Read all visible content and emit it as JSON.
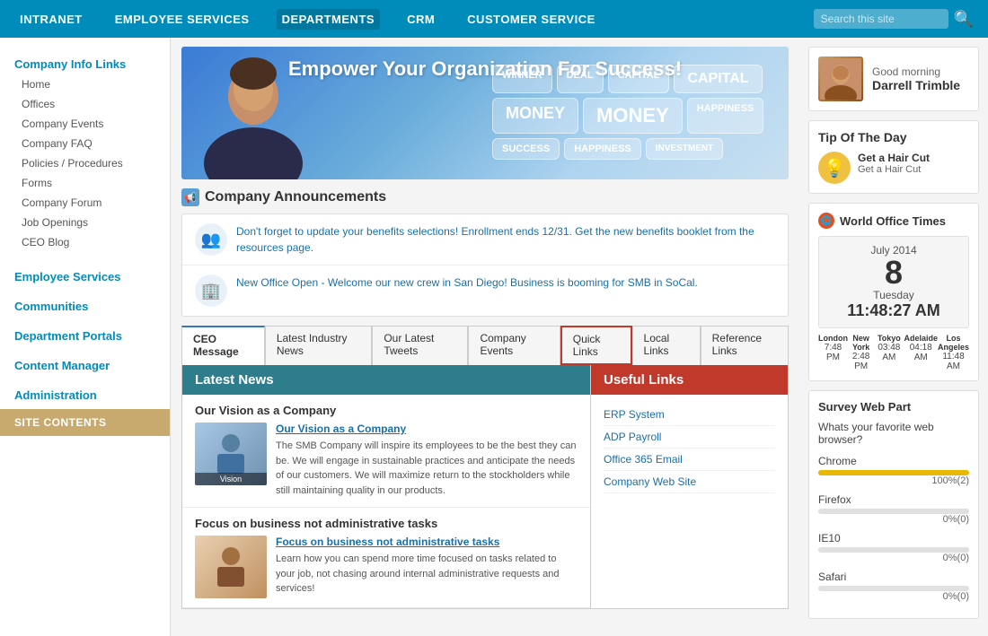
{
  "topnav": {
    "items": [
      {
        "label": "INTRANET",
        "active": false
      },
      {
        "label": "EMPLOYEE SERVICES",
        "active": false
      },
      {
        "label": "DEPARTMENTS",
        "active": true
      },
      {
        "label": "CRM",
        "active": false
      },
      {
        "label": "CUSTOMER SERVICE",
        "active": false
      }
    ],
    "search_placeholder": "Search this site"
  },
  "sidebar": {
    "company_info_label": "Company Info Links",
    "items": [
      {
        "label": "Home"
      },
      {
        "label": "Offices"
      },
      {
        "label": "Company Events"
      },
      {
        "label": "Company FAQ"
      },
      {
        "label": "Policies / Procedures"
      },
      {
        "label": "Forms"
      },
      {
        "label": "Company Forum"
      },
      {
        "label": "Job Openings"
      },
      {
        "label": "CEO Blog"
      }
    ],
    "employee_services_label": "Employee Services",
    "communities_label": "Communities",
    "department_portals_label": "Department Portals",
    "content_manager_label": "Content Manager",
    "administration_label": "Administration",
    "site_contents_label": "SITE CONTENTS"
  },
  "banner": {
    "headline": "Empower Your Organization For Success!",
    "boxes": [
      "WINNER",
      "DEAL",
      "CAPITAL",
      "CAPITAL",
      "MONEY",
      "MONEY",
      "HAPPINESS",
      "SUCCESS",
      "HAPPINESS",
      "INVESTMENT"
    ]
  },
  "announcements": {
    "title": "Company Announcements",
    "items": [
      {
        "icon": "👥",
        "text": "Don't forget to update your benefits selections! Enrollment ends 12/31. Get the new benefits booklet from the resources page."
      },
      {
        "icon": "🏢",
        "text": "New Office Open - Welcome our new crew in San Diego! Business is booming for SMB in SoCal."
      }
    ]
  },
  "tabs": {
    "items": [
      {
        "label": "CEO Message",
        "active": true
      },
      {
        "label": "Latest Industry News",
        "active": false
      },
      {
        "label": "Our Latest Tweets",
        "active": false
      },
      {
        "label": "Company Events",
        "active": false
      },
      {
        "label": "Quick Links",
        "active": false,
        "highlight": true
      },
      {
        "label": "Local Links",
        "active": false
      },
      {
        "label": "Reference Links",
        "active": false
      }
    ],
    "left_header": "Latest News",
    "right_header": "Useful Links",
    "news_items": [
      {
        "title": "Our Vision as a Company",
        "link_text": "Our Vision as a Company",
        "body": "The SMB Company will inspire its employees to be the best they can be. We will engage in sustainable practices and anticipate the needs of our customers. We will maximize return to the stockholders while still maintaining quality in our products.",
        "img_label": "Vision"
      },
      {
        "title": "Focus on business not administrative tasks",
        "link_text": "Focus on business not administrative tasks",
        "body": "Learn how you can spend more time focused on tasks related to your job, not chasing around internal administrative requests and services!",
        "img_label": ""
      }
    ],
    "useful_links": [
      {
        "label": "ERP System"
      },
      {
        "label": "ADP Payroll"
      },
      {
        "label": "Office 365 Email"
      },
      {
        "label": "Company Web Site"
      }
    ]
  },
  "profile": {
    "greeting": "Good morning",
    "name": "Darrell Trimble"
  },
  "tip": {
    "title": "Tip Of The Day",
    "item_title": "Get a Hair Cut",
    "item_body": "Get a Hair Cut"
  },
  "world_times": {
    "title": "World Office Times",
    "month": "July 2014",
    "day": "8",
    "weekday": "Tuesday",
    "time": "11:48:27 AM",
    "cities": [
      {
        "name": "London",
        "time": "7:48 PM"
      },
      {
        "name": "New York",
        "time": "2:48 PM"
      },
      {
        "name": "Tokyo",
        "time": "03:48 AM"
      },
      {
        "name": "Adelaide",
        "time": "04:18 AM"
      },
      {
        "name": "Los Angeles",
        "time": "11:48 AM"
      }
    ]
  },
  "survey": {
    "title": "Survey Web Part",
    "question": "Whats your favorite web browser?",
    "items": [
      {
        "browser": "Chrome",
        "pct": 100,
        "count": 2,
        "color": "#e8b800"
      },
      {
        "browser": "Firefox",
        "pct": 0,
        "count": 0,
        "color": "#e8b800"
      },
      {
        "browser": "IE10",
        "pct": 0,
        "count": 0,
        "color": "#e8b800"
      },
      {
        "browser": "Safari",
        "pct": 0,
        "count": 0,
        "color": "#e8b800"
      }
    ]
  }
}
